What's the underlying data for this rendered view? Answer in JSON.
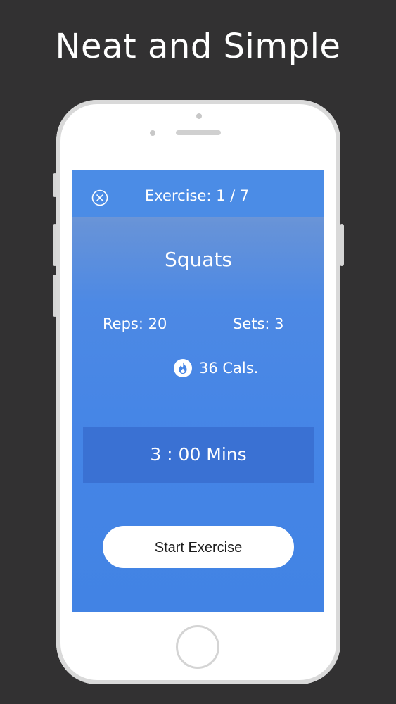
{
  "headline": "Neat and Simple",
  "workout": {
    "header_title": "Exercise: 1 / 7",
    "exercise_name": "Squats",
    "reps": "Reps: 20",
    "sets": "Sets: 3",
    "calories": "36 Cals.",
    "timer": "3 : 00 Mins",
    "start_button_label": "Start Exercise"
  },
  "icons": {
    "close": "close-icon",
    "calories": "flame-icon"
  },
  "colors": {
    "background": "#323132",
    "screen_blue": "#4585e6",
    "timer_box": "#3a71d3",
    "button_bg": "#ffffff"
  }
}
